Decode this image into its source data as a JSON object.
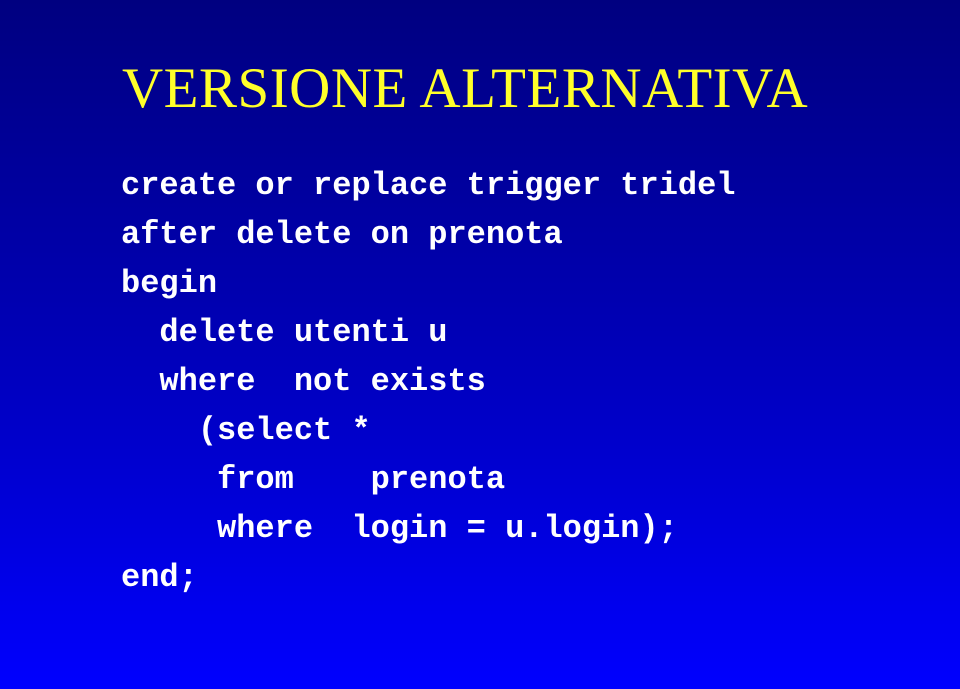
{
  "slide": {
    "title": "VERSIONE ALTERNATIVA",
    "background": {
      "gradient_from": "#000080",
      "gradient_to": "#0000ff",
      "direction": "top-to-bottom"
    },
    "title_color": "#ffff2a",
    "code_color": "#ffffff"
  },
  "code": {
    "language": "sql",
    "lines": [
      "create or replace trigger tridel",
      "after delete on prenota",
      "begin",
      "  delete utenti u",
      "  where  not exists",
      "    (select *",
      "     from    prenota",
      "     where  login = u.login);",
      "end;"
    ]
  }
}
